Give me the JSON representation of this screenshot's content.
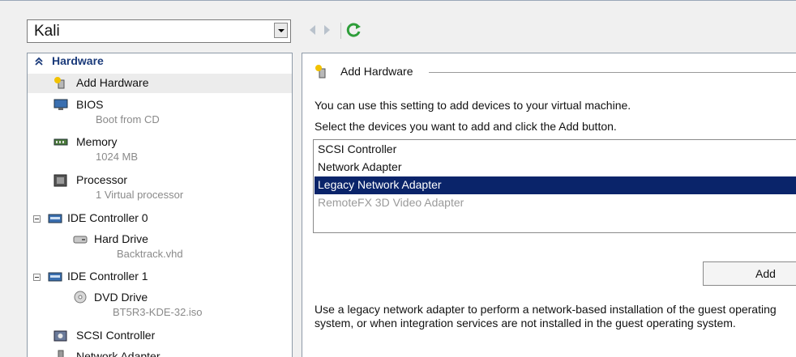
{
  "vm_selector": {
    "value": "Kali"
  },
  "tree": {
    "section_title": "Hardware",
    "items": [
      {
        "label": "Add Hardware",
        "sub": ""
      },
      {
        "label": "BIOS",
        "sub": "Boot from CD"
      },
      {
        "label": "Memory",
        "sub": "1024 MB"
      },
      {
        "label": "Processor",
        "sub": "1 Virtual processor"
      },
      {
        "label": "IDE Controller 0",
        "sub": ""
      },
      {
        "label": "Hard Drive",
        "sub": "Backtrack.vhd"
      },
      {
        "label": "IDE Controller 1",
        "sub": ""
      },
      {
        "label": "DVD Drive",
        "sub": "BT5R3-KDE-32.iso"
      },
      {
        "label": "SCSI Controller",
        "sub": ""
      },
      {
        "label": "Network Adapter",
        "sub": ""
      }
    ]
  },
  "details": {
    "title": "Add Hardware",
    "line1": "You can use this setting to add devices to your virtual machine.",
    "line2": "Select the devices you want to add and click the Add button.",
    "devices": [
      {
        "label": "SCSI Controller",
        "state": "normal"
      },
      {
        "label": "Network Adapter",
        "state": "normal"
      },
      {
        "label": "Legacy Network Adapter",
        "state": "selected"
      },
      {
        "label": "RemoteFX 3D Video Adapter",
        "state": "disabled"
      }
    ],
    "add_button": "Add",
    "description": "Use a legacy network adapter to perform a network-based installation of the guest operating system, or when integration services are not installed in the guest operating system."
  },
  "colors": {
    "selection": "#0a246a",
    "section_title": "#1a3a7a",
    "refresh_icon": "#2e9e3a"
  },
  "icons": [
    "chevron-up-icon",
    "add-hardware-icon",
    "bios-icon",
    "memory-icon",
    "processor-icon",
    "ide-controller-icon",
    "hard-drive-icon",
    "dvd-drive-icon",
    "scsi-controller-icon",
    "network-adapter-icon",
    "refresh-icon"
  ]
}
